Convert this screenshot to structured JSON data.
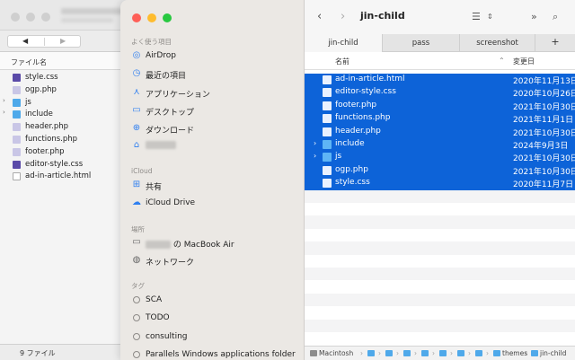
{
  "back_window": {
    "column_header": "ファイル名",
    "files": [
      {
        "name": "style.css",
        "type": "css"
      },
      {
        "name": "ogp.php",
        "type": "php"
      },
      {
        "name": "js",
        "type": "folder"
      },
      {
        "name": "include",
        "type": "folder"
      },
      {
        "name": "header.php",
        "type": "php"
      },
      {
        "name": "functions.php",
        "type": "php"
      },
      {
        "name": "footer.php",
        "type": "php"
      },
      {
        "name": "editor-style.css",
        "type": "css"
      },
      {
        "name": "ad-in-article.html",
        "type": "html"
      }
    ],
    "status": "9 ファイル"
  },
  "sidebar": {
    "favorites_label": "よく使う項目",
    "favorites": [
      {
        "label": "AirDrop",
        "icon": "airdrop-icon"
      },
      {
        "label": "最近の項目",
        "icon": "clock-icon"
      },
      {
        "label": "アプリケーション",
        "icon": "applications-icon"
      },
      {
        "label": "デスクトップ",
        "icon": "desktop-icon"
      },
      {
        "label": "ダウンロード",
        "icon": "download-icon"
      }
    ],
    "icloud_label": "iCloud",
    "icloud": [
      {
        "label": "共有",
        "icon": "shared-folder-icon"
      },
      {
        "label": "iCloud Drive",
        "icon": "cloud-icon"
      }
    ],
    "locations_label": "場所",
    "macbook_suffix": "の MacBook Air",
    "network_label": "ネットワーク",
    "tags_label": "タグ",
    "tags": [
      "SCA",
      "TODO",
      "consulting",
      "Parallels Windows applications folder"
    ]
  },
  "main": {
    "title": "jin-child",
    "tabs": [
      "jin-child",
      "pass",
      "screenshot"
    ],
    "col_name": "名前",
    "col_date": "変更日",
    "rows": [
      {
        "name": "ad-in-article.html",
        "date": "2020年11月13日",
        "type": "doc",
        "folder": false
      },
      {
        "name": "editor-style.css",
        "date": "2020年10月26日",
        "type": "doc",
        "folder": false
      },
      {
        "name": "footer.php",
        "date": "2021年10月30日",
        "type": "doc",
        "folder": false
      },
      {
        "name": "functions.php",
        "date": "2021年11月1日",
        "type": "doc",
        "folder": false
      },
      {
        "name": "header.php",
        "date": "2021年10月30日",
        "type": "doc",
        "folder": false
      },
      {
        "name": "include",
        "date": "2024年9月3日",
        "type": "folder",
        "folder": true
      },
      {
        "name": "js",
        "date": "2021年10月30日",
        "type": "folder",
        "folder": true
      },
      {
        "name": "ogp.php",
        "date": "2021年10月30日",
        "type": "doc",
        "folder": false
      },
      {
        "name": "style.css",
        "date": "2020年11月7日",
        "type": "doc",
        "folder": false
      }
    ],
    "path": [
      "Macintosh",
      "themes",
      "jin-child"
    ]
  },
  "colors": {
    "selection": "#0d63d8",
    "sidebar_bg": "#ebe8e4",
    "accent": "#2f7ff0"
  }
}
